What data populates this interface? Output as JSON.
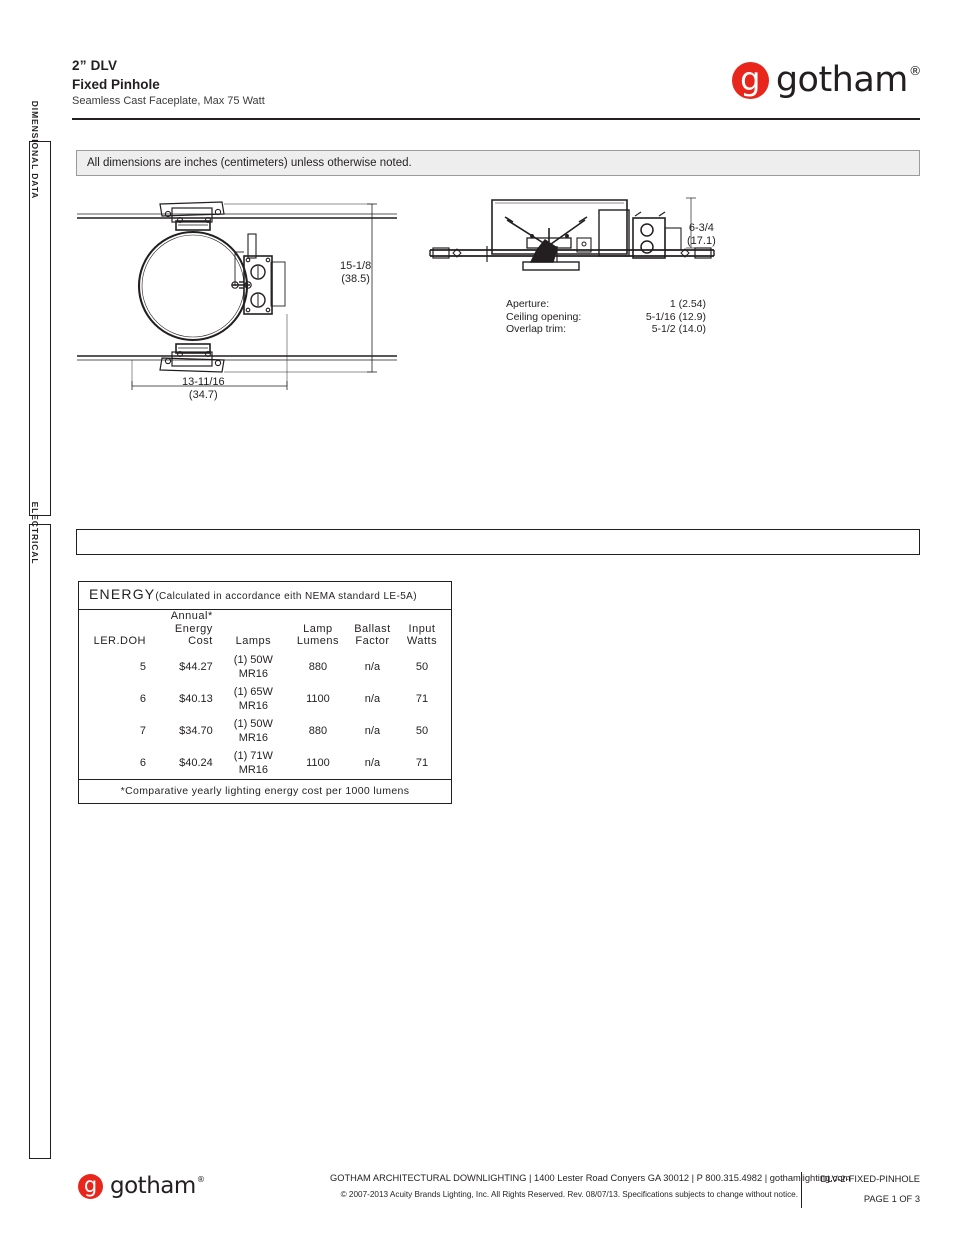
{
  "header": {
    "title": "2” DLV",
    "subtitle": "Fixed Pinhole",
    "description": "Seamless Cast Faceplate, Max 75 Watt"
  },
  "brand": {
    "mark_letter": "g",
    "wordmark": "gotham",
    "registered": "®",
    "red": "#e8261c",
    "ink": "#231f20"
  },
  "side_tabs": {
    "dimensional": "DIMENSIONAL  DATA",
    "electrical": "ELECTRICAL"
  },
  "note_bar": {
    "text": "All dimensions are inches (centimeters) unless otherwise noted."
  },
  "drawings": {
    "plan_view": {
      "height_dim": "15-1/8",
      "height_dim_metric": "(38.5)",
      "width_dim": "13-11/16",
      "width_dim_metric": "(34.7)"
    },
    "section_view": {
      "depth_dim": "6-3/4",
      "depth_dim_metric": "(17.1)"
    },
    "specs": [
      {
        "label": "Aperture:",
        "value": "1 (2.54)"
      },
      {
        "label": "Ceiling  opening:",
        "value": "5-1/16 (12.9)"
      },
      {
        "label": "Overlap  trim:",
        "value": "5-1/2 (14.0)"
      }
    ]
  },
  "energy": {
    "title": "ENERGY",
    "title_note": "(Calculated in accordance eith NEMA standard  LE-5A)",
    "columns": {
      "ler": "LER.DOH",
      "cost_line1": "Annual*",
      "cost_line2": "Energy",
      "cost_line3": "Cost",
      "lamps": "Lamps",
      "lumens_line1": "Lamp",
      "lumens_line2": "Lumens",
      "ballast_line1": "Ballast",
      "ballast_line2": "Factor",
      "watts_line1": "Input",
      "watts_line2": "Watts"
    },
    "rows": [
      {
        "ler": "5",
        "cost": "$44.27",
        "lamps": "(1) 50W MR16",
        "lumens": "880",
        "ballast": "n/a",
        "watts": "50"
      },
      {
        "ler": "6",
        "cost": "$40.13",
        "lamps": "(1) 65W MR16",
        "lumens": "1100",
        "ballast": "n/a",
        "watts": "71"
      },
      {
        "ler": "7",
        "cost": "$34.70",
        "lamps": "(1) 50W MR16",
        "lumens": "880",
        "ballast": "n/a",
        "watts": "50"
      },
      {
        "ler": "6",
        "cost": "$40.24",
        "lamps": "(1) 71W MR16",
        "lumens": "1100",
        "ballast": "n/a",
        "watts": "71"
      }
    ],
    "footnote": "*Comparative yearly lighting energy cost per 1000 lumens"
  },
  "footer": {
    "company_line": "GOTHAM ARCHITECTURAL DOWNLIGHTING  |  1400 Lester Road Conyers GA 30012  |  P 800.315.4982  |  gothamlighting.com",
    "copyright_line": "© 2007-2013 Acuity Brands Lighting, Inc. All Rights Reserved. Rev. 08/07/13. Specifications subjects to change without notice.",
    "doc_code": "DLV-2-FIXED-PINHOLE",
    "page": "PAGE 1 OF 3"
  }
}
